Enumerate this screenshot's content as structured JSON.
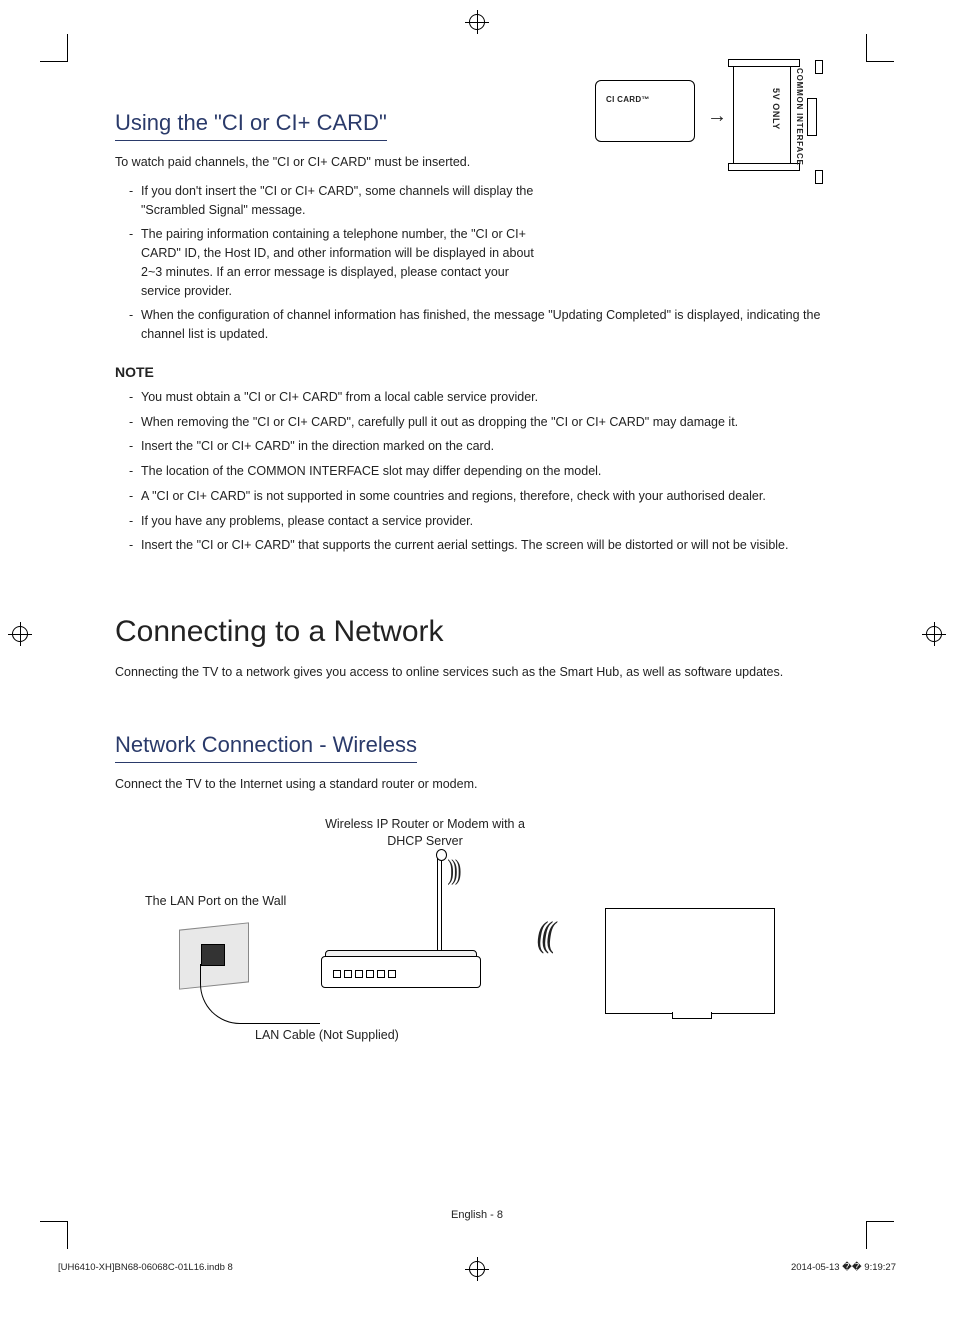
{
  "section1": {
    "title": "Using the \"CI or CI+ CARD\"",
    "intro": "To watch paid channels, the \"CI or CI+ CARD\" must be inserted.",
    "bullets": [
      "If you don't insert the \"CI or CI+ CARD\", some channels will display the \"Scrambled Signal\" message.",
      "The pairing information containing a telephone number, the \"CI or CI+ CARD\" ID, the Host ID, and other information will be displayed in about 2~3 minutes. If an error message is displayed, please contact your service provider.",
      "When the configuration of channel information has finished, the message \"Updating Completed\" is displayed, indicating the channel list is updated."
    ],
    "illustration": {
      "card_label": "CI CARD™",
      "slot_label": "COMMON INTERFACE",
      "voltage_label": "5V ONLY"
    }
  },
  "note": {
    "header": "NOTE",
    "bullets": [
      "You must obtain a \"CI or CI+ CARD\" from a local cable service provider.",
      "When removing the \"CI or CI+ CARD\", carefully pull it out as dropping the \"CI or CI+ CARD\" may damage it.",
      "Insert the \"CI or CI+ CARD\" in the direction marked on the card.",
      "The location of the COMMON INTERFACE slot may differ depending on the model.",
      "A \"CI or CI+ CARD\" is not supported in some countries and regions, therefore, check with your authorised dealer.",
      "If you have any problems, please contact a service provider.",
      "Insert the \"CI or CI+ CARD\" that supports the current aerial settings. The screen will be distorted or will not be visible."
    ]
  },
  "section2": {
    "heading": "Connecting to a Network",
    "intro": "Connecting the TV to a network gives you access to online services such as the Smart Hub, as well as software updates."
  },
  "section3": {
    "title": "Network Connection - Wireless",
    "intro": "Connect the TV to the Internet using a standard router or modem.",
    "labels": {
      "router": "Wireless IP Router or Modem with a DHCP Server",
      "wall": "The LAN Port on the Wall",
      "cable": "LAN Cable (Not Supplied)"
    }
  },
  "footer": {
    "page": "English - 8",
    "file": "[UH6410-XH]BN68-06068C-01L16.indb   8",
    "timestamp": "2014-05-13   �� 9:19:27"
  }
}
